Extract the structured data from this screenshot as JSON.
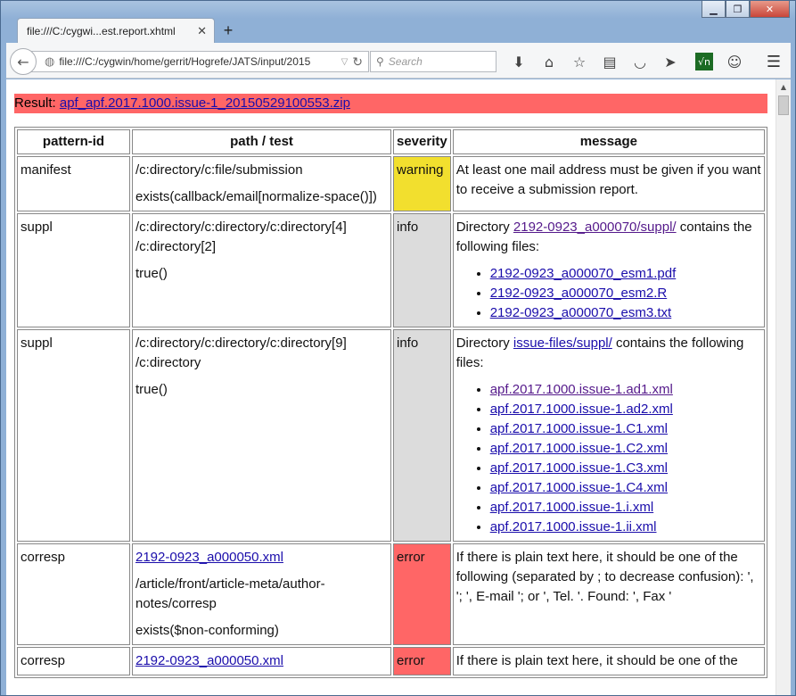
{
  "tab": {
    "title": "file:///C:/cygwi...est.report.xhtml",
    "close": "✕",
    "new": "+"
  },
  "nav": {
    "url": "file:///C:/cygwin/home/gerrit/Hogrefe/JATS/input/2015",
    "search_placeholder": "Search"
  },
  "icons": {
    "back": "arrow-left",
    "globe": "globe",
    "download": "download-arrow",
    "home": "home",
    "bookmark": "star",
    "reader": "reading-list",
    "pocket": "pocket",
    "send": "send",
    "sqrt": "√n",
    "chat": "chat",
    "menu": "hamburger"
  },
  "result": {
    "label": "Result:",
    "file": "apf_apf.2017.1000.issue-1_20150529100553.zip"
  },
  "table": {
    "headers": {
      "pattern": "pattern-id",
      "path": "path / test",
      "severity": "severity",
      "message": "message"
    },
    "rows": [
      {
        "pattern": "manifest",
        "path": "/c:directory/c:file/submission",
        "test": "exists(callback/email[normalize-space()])",
        "severity": "warning",
        "message": "At least one mail address must be given if you want to receive a submission report."
      },
      {
        "pattern": "suppl",
        "path": "/c:directory/c:directory/c:directory[4] /c:directory[2]",
        "test": "true()",
        "severity": "info",
        "msg_prefix": "Directory",
        "msg_link": "2192-0923_a000070/suppl/",
        "msg_suffix": "contains the following files:",
        "files": [
          "2192-0923_a000070_esm1.pdf",
          "2192-0923_a000070_esm2.R",
          "2192-0923_a000070_esm3.txt"
        ]
      },
      {
        "pattern": "suppl",
        "path": "/c:directory/c:directory/c:directory[9] /c:directory",
        "test": "true()",
        "severity": "info",
        "msg_prefix": "Directory",
        "msg_link": "issue-files/suppl/",
        "msg_suffix": "contains the following files:",
        "files": [
          "apf.2017.1000.issue-1.ad1.xml",
          "apf.2017.1000.issue-1.ad2.xml",
          "apf.2017.1000.issue-1.C1.xml",
          "apf.2017.1000.issue-1.C2.xml",
          "apf.2017.1000.issue-1.C3.xml",
          "apf.2017.1000.issue-1.C4.xml",
          "apf.2017.1000.issue-1.i.xml",
          "apf.2017.1000.issue-1.ii.xml"
        ]
      },
      {
        "pattern": "corresp",
        "file_link": "2192-0923_a000050.xml",
        "path": "/article/front/article-meta/author-notes/corresp",
        "test": "exists($non-conforming)",
        "severity": "error",
        "message": "If there is plain text here, it should be one of the following (separated by ; to decrease confusion): ', '; ', E-mail '; or ', Tel. '. Found: ', Fax '"
      },
      {
        "pattern": "corresp",
        "file_link": "2192-0923_a000050.xml",
        "severity": "error",
        "message": "If there is plain text here, it should be one of the"
      }
    ]
  }
}
